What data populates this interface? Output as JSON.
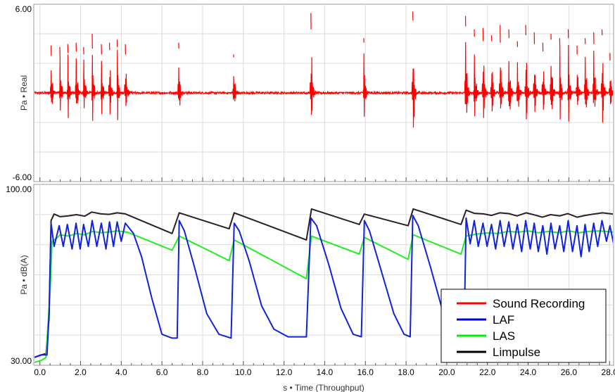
{
  "chart_data": [
    {
      "type": "line",
      "ylabel": "Pa • Real",
      "ylim": [
        -6,
        6
      ],
      "y_ticks": [
        "6.00",
        "-6.00"
      ],
      "y_tick_values": [
        6,
        -6
      ],
      "xlim": [
        -0.3,
        28.2
      ],
      "grid": true,
      "series": [
        {
          "name": "Sound Recording",
          "color": "#ff0000",
          "baseline": 0,
          "noise_amplitude": 0.07,
          "bursts": [
            {
              "t": 0.55,
              "peak": 3.2,
              "trough": -2.5
            },
            {
              "t": 0.98,
              "peak": 3.1,
              "trough": -2.4
            },
            {
              "t": 1.37,
              "peak": 3.3,
              "trough": -2.7
            },
            {
              "t": 1.78,
              "peak": 3.4,
              "trough": -2.8
            },
            {
              "t": 2.15,
              "peak": 3.1,
              "trough": -2.6
            },
            {
              "t": 2.57,
              "peak": 4.0,
              "trough": -3.0
            },
            {
              "t": 3.02,
              "peak": 3.3,
              "trough": -2.6
            },
            {
              "t": 3.42,
              "peak": 3.4,
              "trough": -2.9
            },
            {
              "t": 3.8,
              "peak": 3.6,
              "trough": -3.1
            },
            {
              "t": 4.2,
              "peak": 3.3,
              "trough": -2.6
            },
            {
              "t": 6.82,
              "peak": 3.4,
              "trough": -3.0
            },
            {
              "t": 9.52,
              "peak": 2.6,
              "trough": -2.4
            },
            {
              "t": 13.32,
              "peak": 5.4,
              "trough": -4.3
            },
            {
              "t": 15.92,
              "peak": 3.7,
              "trough": -3.4
            },
            {
              "t": 18.33,
              "peak": 5.5,
              "trough": -4.9
            },
            {
              "t": 20.92,
              "peak": 5.2,
              "trough": -4.5
            },
            {
              "t": 21.35,
              "peak": 4.3,
              "trough": -3.8
            },
            {
              "t": 21.78,
              "peak": 4.4,
              "trough": -3.5
            },
            {
              "t": 22.2,
              "peak": 3.9,
              "trough": -3.5
            },
            {
              "t": 22.62,
              "peak": 4.6,
              "trough": -3.4
            },
            {
              "t": 23.05,
              "peak": 4.3,
              "trough": -3.7
            },
            {
              "t": 23.47,
              "peak": 3.5,
              "trough": -3.1
            },
            {
              "t": 23.88,
              "peak": 4.6,
              "trough": -3.9
            },
            {
              "t": 24.3,
              "peak": 4.1,
              "trough": -3.3
            },
            {
              "t": 24.72,
              "peak": 3.4,
              "trough": -2.8
            },
            {
              "t": 25.12,
              "peak": 4.0,
              "trough": -3.6
            },
            {
              "t": 25.55,
              "peak": 3.7,
              "trough": -2.9
            },
            {
              "t": 25.97,
              "peak": 4.3,
              "trough": -3.7
            },
            {
              "t": 26.4,
              "peak": 3.2,
              "trough": -2.6
            },
            {
              "t": 26.8,
              "peak": 3.7,
              "trough": -3.3
            },
            {
              "t": 27.22,
              "peak": 4.1,
              "trough": -3.3
            },
            {
              "t": 27.63,
              "peak": 4.3,
              "trough": -3.9
            },
            {
              "t": 28.02,
              "peak": 2.7,
              "trough": -2.2
            }
          ]
        }
      ]
    },
    {
      "type": "line",
      "ylabel": "Pa • dB(A)",
      "xlabel": "s • Time (Throughput)",
      "ylim": [
        30,
        100
      ],
      "y_ticks": [
        "100.00",
        "30.00"
      ],
      "y_tick_values": [
        100,
        30
      ],
      "xlim": [
        -0.3,
        28.2
      ],
      "x_ticks": [
        "0.0",
        "2.0",
        "4.0",
        "6.0",
        "8.0",
        "10.0",
        "12.0",
        "14.0",
        "16.0",
        "18.0",
        "20.0",
        "22.0",
        "24.0",
        "26.0",
        "28.0"
      ],
      "x_tick_values": [
        0,
        2,
        4,
        6,
        8,
        10,
        12,
        14,
        16,
        18,
        20,
        22,
        24,
        26,
        28
      ],
      "grid": true,
      "legend": {
        "position": "bottom-right",
        "entries": [
          {
            "label": "Sound Recording",
            "color": "#ff0000"
          },
          {
            "label": "LAF",
            "color": "#0000dd"
          },
          {
            "label": "LAS",
            "color": "#00ee00"
          },
          {
            "label": "Limpulse",
            "color": "#000000"
          }
        ]
      },
      "series": [
        {
          "name": "Limpulse",
          "color": "#2b1f24",
          "points": [
            [
              -0.3,
              33
            ],
            [
              0.05,
              34
            ],
            [
              0.3,
              34.5
            ],
            [
              0.45,
              48
            ],
            [
              0.55,
              86
            ],
            [
              0.7,
              88.5
            ],
            [
              1.0,
              87.5
            ],
            [
              1.4,
              87.8
            ],
            [
              1.8,
              88.3
            ],
            [
              2.2,
              87.7
            ],
            [
              2.55,
              89.3
            ],
            [
              3.0,
              88.6
            ],
            [
              3.4,
              88.4
            ],
            [
              3.8,
              89.0
            ],
            [
              4.2,
              88.6
            ],
            [
              6.5,
              81.0
            ],
            [
              6.85,
              89.0
            ],
            [
              9.3,
              82.8
            ],
            [
              9.55,
              89.0
            ],
            [
              13.1,
              78.5
            ],
            [
              13.35,
              90.5
            ],
            [
              15.7,
              84.5
            ],
            [
              15.95,
              88.5
            ],
            [
              18.1,
              84.0
            ],
            [
              18.35,
              90.5
            ],
            [
              20.7,
              84.5
            ],
            [
              20.95,
              90.0
            ],
            [
              21.35,
              88.8
            ],
            [
              21.8,
              88.6
            ],
            [
              22.2,
              88.0
            ],
            [
              22.6,
              89.0
            ],
            [
              23.05,
              88.7
            ],
            [
              23.45,
              87.8
            ],
            [
              23.9,
              89.0
            ],
            [
              24.3,
              88.2
            ],
            [
              24.7,
              87.3
            ],
            [
              25.1,
              88.3
            ],
            [
              25.55,
              87.8
            ],
            [
              25.95,
              88.7
            ],
            [
              26.4,
              87.3
            ],
            [
              26.8,
              88.0
            ],
            [
              27.2,
              88.5
            ],
            [
              27.65,
              89.0
            ],
            [
              28.2,
              88.5
            ]
          ]
        },
        {
          "name": "LAS",
          "color": "#22ee22",
          "points": [
            [
              -0.3,
              31
            ],
            [
              0.1,
              32
            ],
            [
              0.3,
              33
            ],
            [
              0.5,
              58
            ],
            [
              0.6,
              78
            ],
            [
              0.8,
              79
            ],
            [
              1.0,
              80.5
            ],
            [
              1.4,
              80.0
            ],
            [
              1.8,
              81.0
            ],
            [
              2.2,
              80.5
            ],
            [
              2.6,
              81.8
            ],
            [
              3.0,
              81.3
            ],
            [
              3.4,
              81.6
            ],
            [
              3.8,
              82.0
            ],
            [
              4.3,
              81.5
            ],
            [
              6.5,
              74.5
            ],
            [
              6.85,
              80.0
            ],
            [
              9.3,
              70.5
            ],
            [
              9.55,
              78.5
            ],
            [
              13.1,
              63.5
            ],
            [
              13.35,
              80.0
            ],
            [
              15.7,
              73.0
            ],
            [
              15.95,
              79.5
            ],
            [
              18.1,
              71.0
            ],
            [
              18.35,
              80.5
            ],
            [
              20.7,
              73.0
            ],
            [
              20.95,
              80.0
            ],
            [
              21.5,
              80.8
            ],
            [
              22.0,
              81.2
            ],
            [
              22.5,
              81.0
            ],
            [
              23.0,
              81.8
            ],
            [
              23.5,
              81.5
            ],
            [
              24.0,
              82.0
            ],
            [
              24.5,
              81.3
            ],
            [
              25.0,
              81.8
            ],
            [
              25.5,
              81.3
            ],
            [
              26.0,
              82.0
            ],
            [
              26.5,
              81.3
            ],
            [
              27.0,
              81.8
            ],
            [
              27.5,
              82.0
            ],
            [
              28.2,
              81.5
            ]
          ]
        },
        {
          "name": "LAF",
          "color": "#1122dd",
          "points": [
            [
              -0.3,
              33
            ],
            [
              0.1,
              34
            ],
            [
              0.35,
              34
            ],
            [
              0.45,
              50
            ],
            [
              0.55,
              85
            ],
            [
              0.7,
              76
            ],
            [
              0.95,
              84
            ],
            [
              1.15,
              76
            ],
            [
              1.35,
              84.5
            ],
            [
              1.58,
              75
            ],
            [
              1.78,
              85
            ],
            [
              1.98,
              75
            ],
            [
              2.15,
              84.5
            ],
            [
              2.38,
              76
            ],
            [
              2.57,
              86
            ],
            [
              2.8,
              76
            ],
            [
              3.02,
              85
            ],
            [
              3.25,
              75
            ],
            [
              3.42,
              85.5
            ],
            [
              3.62,
              76
            ],
            [
              3.8,
              85.5
            ],
            [
              4.0,
              78
            ],
            [
              4.2,
              85
            ],
            [
              4.6,
              81
            ],
            [
              5.0,
              72
            ],
            [
              5.5,
              56
            ],
            [
              6.0,
              42
            ],
            [
              6.5,
              40.5
            ],
            [
              6.75,
              40.5
            ],
            [
              6.85,
              86
            ],
            [
              7.1,
              82
            ],
            [
              7.6,
              68
            ],
            [
              8.2,
              50
            ],
            [
              8.8,
              42
            ],
            [
              9.4,
              40.5
            ],
            [
              9.55,
              85
            ],
            [
              9.8,
              82
            ],
            [
              10.3,
              70
            ],
            [
              10.9,
              53
            ],
            [
              11.5,
              44
            ],
            [
              12.2,
              41
            ],
            [
              13.1,
              41
            ],
            [
              13.32,
              87
            ],
            [
              13.6,
              84
            ],
            [
              14.2,
              69
            ],
            [
              14.8,
              52
            ],
            [
              15.4,
              42
            ],
            [
              15.8,
              41
            ],
            [
              15.95,
              86
            ],
            [
              16.2,
              82
            ],
            [
              16.8,
              66
            ],
            [
              17.4,
              50
            ],
            [
              17.9,
              42
            ],
            [
              18.2,
              41
            ],
            [
              18.33,
              88
            ],
            [
              18.6,
              84
            ],
            [
              19.2,
              68
            ],
            [
              19.8,
              51
            ],
            [
              20.4,
              42
            ],
            [
              20.85,
              41
            ],
            [
              20.95,
              87
            ],
            [
              21.15,
              77
            ],
            [
              21.35,
              86
            ],
            [
              21.55,
              76
            ],
            [
              21.78,
              85
            ],
            [
              21.98,
              76
            ],
            [
              22.2,
              84.5
            ],
            [
              22.4,
              75
            ],
            [
              22.62,
              86
            ],
            [
              22.82,
              76
            ],
            [
              23.05,
              85.5
            ],
            [
              23.25,
              75
            ],
            [
              23.47,
              84.5
            ],
            [
              23.68,
              74
            ],
            [
              23.88,
              86
            ],
            [
              24.1,
              75
            ],
            [
              24.3,
              85
            ],
            [
              24.5,
              74
            ],
            [
              24.72,
              84
            ],
            [
              24.92,
              73
            ],
            [
              25.12,
              85
            ],
            [
              25.32,
              75
            ],
            [
              25.55,
              84
            ],
            [
              25.75,
              74
            ],
            [
              25.97,
              86
            ],
            [
              26.18,
              74
            ],
            [
              26.4,
              84
            ],
            [
              26.6,
              72
            ],
            [
              26.8,
              84.5
            ],
            [
              27.0,
              74
            ],
            [
              27.22,
              85
            ],
            [
              27.42,
              76
            ],
            [
              27.63,
              86
            ],
            [
              27.85,
              78
            ],
            [
              28.02,
              84
            ],
            [
              28.2,
              77
            ]
          ]
        }
      ]
    }
  ]
}
